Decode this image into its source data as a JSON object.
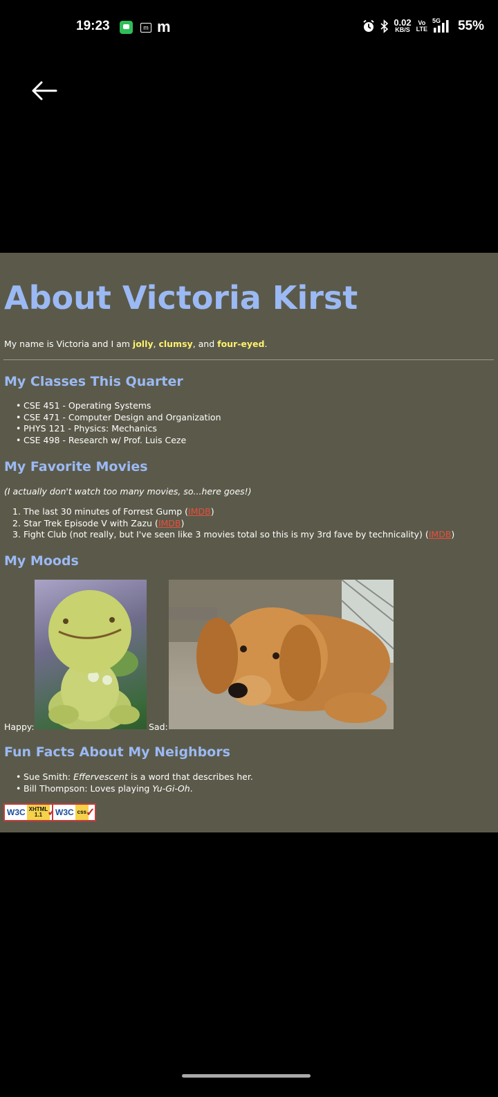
{
  "status_bar": {
    "time": "19:23",
    "net_speed": "0.02",
    "net_unit": "KB/S",
    "volte_top": "Vo",
    "volte_bottom": "LTE",
    "network": "5G",
    "battery": "55%",
    "notif_m_box": "m",
    "notif_m": "m"
  },
  "page": {
    "title": "About Victoria Kirst",
    "intro": {
      "prefix": "My name is Victoria and I am ",
      "adj1": "jolly",
      "sep1": ", ",
      "adj2": "clumsy",
      "sep2": ", and ",
      "adj3": "four-eyed",
      "suffix": "."
    },
    "classes_heading": "My Classes This Quarter",
    "classes": [
      "CSE 451 - Operating Systems",
      "CSE 471 - Computer Design and Organization",
      "PHYS 121 - Physics: Mechanics",
      "CSE 498 - Research w/ Prof. Luis Ceze"
    ],
    "movies_heading": "My Favorite Movies",
    "movies_note": "(I actually don't watch too many movies, so...here goes!)",
    "movies": [
      {
        "num": "1.",
        "text": "The last 30 minutes of Forrest Gump (",
        "link": "IMDB",
        "after": ")"
      },
      {
        "num": "2.",
        "text": "Star Trek Episode V with Zazu (",
        "link": "IMDB",
        "after": ")"
      },
      {
        "num": "3.",
        "text": "Fight Club (not really, but I've seen like 3 movies total so this is my 3rd fave by technicality) (",
        "link": "IMDB",
        "after": ")"
      }
    ],
    "moods_heading": "My Moods",
    "happy_label": "Happy:",
    "sad_label": "Sad:",
    "neighbors_heading": "Fun Facts About My Neighbors",
    "neighbors": [
      {
        "name": "Sue Smith: ",
        "em": "Effervescent",
        "rest": " is a word that describes her."
      },
      {
        "name": "Bill Thompson: Loves playing ",
        "em": "Yu-Gi-Oh",
        "rest": "."
      }
    ],
    "badges": [
      {
        "w3c": "W3C",
        "kind_top": "XHTML",
        "kind_bottom": "1.1",
        "check": "✓"
      },
      {
        "w3c": "W3C",
        "kind_top": "css",
        "kind_bottom": "",
        "check": "✓"
      }
    ]
  },
  "colors": {
    "page_bg": "#5b5a4a",
    "heading": "#9bb9f4",
    "highlight": "#fff16d",
    "link": "#ea4e3c"
  },
  "icons": [
    "message-icon",
    "m-app-icon",
    "alarm-icon",
    "bluetooth-icon",
    "signal-icon",
    "back-arrow-icon"
  ]
}
